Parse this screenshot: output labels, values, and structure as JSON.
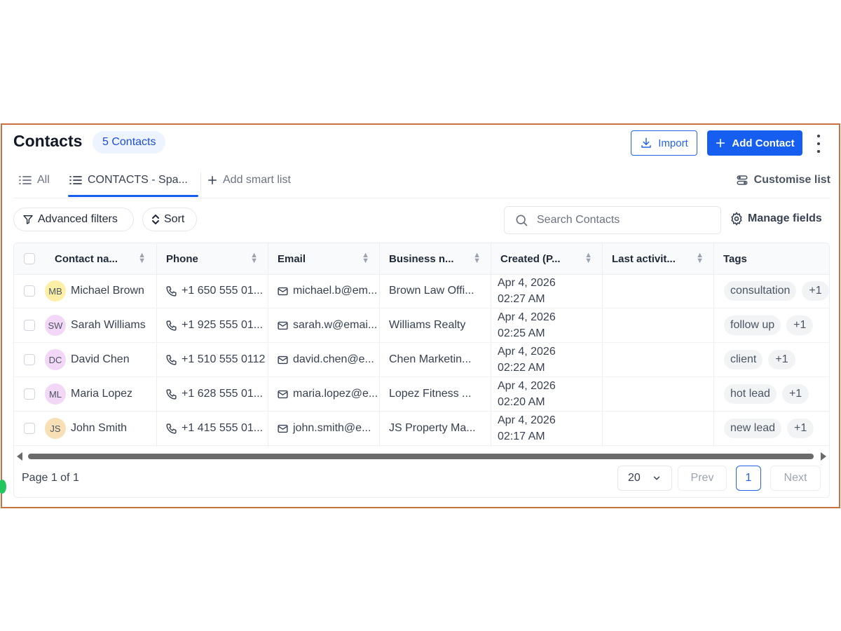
{
  "header": {
    "title": "Contacts",
    "count_badge": "5 Contacts",
    "import_label": "Import",
    "add_contact_label": "Add Contact"
  },
  "tabs": {
    "all_label": "All",
    "active_label": "CONTACTS - Spa...",
    "add_smart_list_label": "Add smart list",
    "customise_label": "Customise list"
  },
  "toolbar": {
    "advanced_filters_label": "Advanced filters",
    "sort_label": "Sort",
    "search_placeholder": "Search Contacts",
    "manage_fields_label": "Manage fields"
  },
  "table": {
    "columns": [
      "Contact na...",
      "Phone",
      "Email",
      "Business n...",
      "Created (P...",
      "Last activit...",
      "Tags"
    ],
    "rows": [
      {
        "initials": "MB",
        "avatar_color": "#fdf0a6",
        "name": "Michael Brown",
        "phone": "+1 650 555 01...",
        "email": "michael.b@em...",
        "business": "Brown Law Offi...",
        "created_date": "Apr 4, 2026",
        "created_time": "02:27 AM",
        "last_activity": "",
        "tag": "consultation",
        "tag_more": "+1"
      },
      {
        "initials": "SW",
        "avatar_color": "#f3d7f7",
        "name": "Sarah Williams",
        "phone": "+1 925 555 01...",
        "email": "sarah.w@emai...",
        "business": "Williams Realty",
        "created_date": "Apr 4, 2026",
        "created_time": "02:25 AM",
        "last_activity": "",
        "tag": "follow up",
        "tag_more": "+1"
      },
      {
        "initials": "DC",
        "avatar_color": "#f3d7f7",
        "name": "David Chen",
        "phone": "+1 510 555 0112",
        "email": "david.chen@e...",
        "business": "Chen Marketin...",
        "created_date": "Apr 4, 2026",
        "created_time": "02:22 AM",
        "last_activity": "",
        "tag": "client",
        "tag_more": "+1"
      },
      {
        "initials": "ML",
        "avatar_color": "#f3d7f7",
        "name": "Maria Lopez",
        "phone": "+1 628 555 01...",
        "email": "maria.lopez@e...",
        "business": "Lopez Fitness ...",
        "created_date": "Apr 4, 2026",
        "created_time": "02:20 AM",
        "last_activity": "",
        "tag": "hot lead",
        "tag_more": "+1"
      },
      {
        "initials": "JS",
        "avatar_color": "#f8dfb5",
        "name": "John Smith",
        "phone": "+1 415 555 01...",
        "email": "john.smith@e...",
        "business": "JS Property Ma...",
        "created_date": "Apr 4, 2026",
        "created_time": "02:17 AM",
        "last_activity": "",
        "tag": "new lead",
        "tag_more": "+1"
      }
    ]
  },
  "pagination": {
    "page_label": "Page 1 of 1",
    "per_page": "20",
    "prev_label": "Prev",
    "current_page": "1",
    "next_label": "Next"
  },
  "colors": {
    "accent": "#155eef",
    "frame_border": "#c8703f"
  },
  "icons": [
    "download-icon",
    "plus-icon",
    "kebab-menu-icon",
    "list-icon",
    "customise-icon",
    "filter-icon",
    "sort-icon",
    "search-icon",
    "gear-icon",
    "phone-icon",
    "mail-icon",
    "chevron-down-icon"
  ]
}
